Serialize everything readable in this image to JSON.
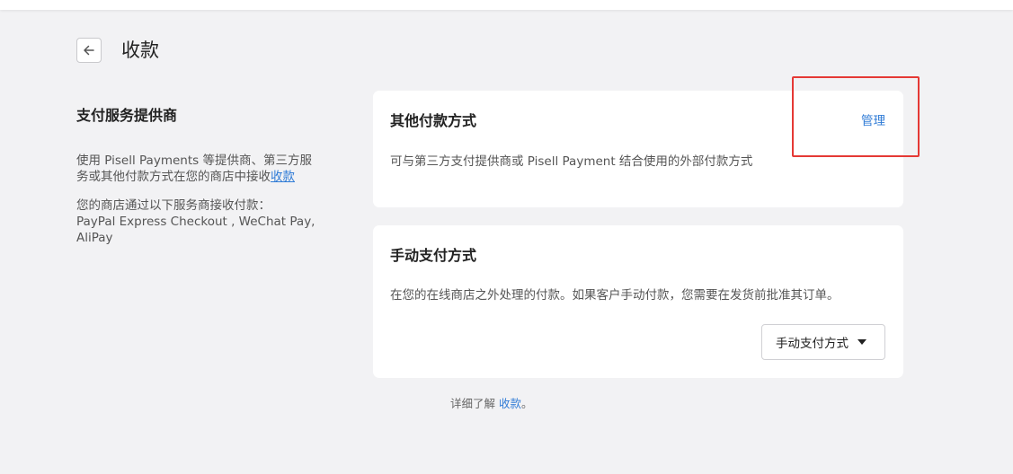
{
  "header": {
    "back_icon": "arrow-left-icon",
    "title": "收款"
  },
  "left": {
    "heading": "支付服务提供商",
    "desc_prefix": "使用 Pisell Payments 等提供商、第三方服务或其他付款方式在您的商店中接收",
    "desc_link": "收款",
    "providers_line1": "您的商店通过以下服务商接收付款：",
    "providers_line2": "PayPal Express Checkout , WeChat Pay, AliPay"
  },
  "other_methods": {
    "title": "其他付款方式",
    "manage_label": "管理",
    "description": "可与第三方支付提供商或 Pisell Payment 结合使用的外部付款方式"
  },
  "manual_methods": {
    "title": "手动支付方式",
    "description": "在您的在线商店之外处理的付款。如果客户手动付款，您需要在发货前批准其订单。",
    "dropdown_label": "手动支付方式",
    "dropdown_icon": "caret-down-icon"
  },
  "footer": {
    "prefix": "详细了解 ",
    "link": "收款",
    "suffix": "。"
  },
  "colors": {
    "accent": "#2f7bd6",
    "highlight": "#e53935",
    "background": "#f2f2f4"
  }
}
